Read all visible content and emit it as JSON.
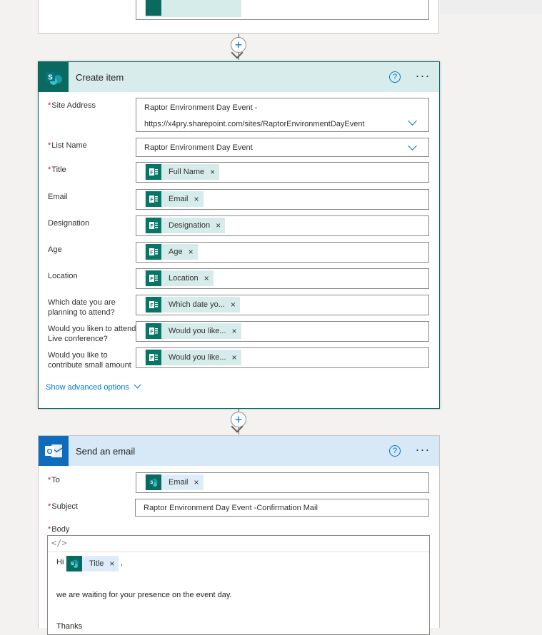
{
  "create_item": {
    "title": "Create item",
    "help_glyph": "?",
    "more_glyph": "···",
    "required_mark": "*",
    "site_address": {
      "label": "Site Address",
      "line1": "Raptor Environment Day Event -",
      "line2": "https://x4pry.sharepoint.com/sites/RaptorEnvironmentDayEvent"
    },
    "list_name": {
      "label": "List Name",
      "value": "Raptor Environment Day Event"
    },
    "title_field": {
      "label": "Title",
      "token": "Full Name"
    },
    "email": {
      "label": "Email",
      "token": "Email"
    },
    "designation": {
      "label": "Designation",
      "token": "Designation"
    },
    "age": {
      "label": "Age",
      "token": "Age"
    },
    "location": {
      "label": "Location",
      "token": "Location"
    },
    "date_attend": {
      "label": "Which date you are planning to attend?",
      "token": "Which date yo..."
    },
    "live_conf": {
      "label": "Would you liken to attend Live conference?",
      "token": "Would you like..."
    },
    "donation": {
      "label": "Would you like to contribute small amount as a donation?",
      "token": "Would you like..."
    },
    "advanced_options": "Show advanced options",
    "token_close": "×"
  },
  "send_email": {
    "title": "Send an email",
    "help_glyph": "?",
    "more_glyph": "···",
    "required_mark": "*",
    "to": {
      "label": "To",
      "token": "Email"
    },
    "subject": {
      "label": "Subject",
      "value": "Raptor Environment Day Event -Confirmation Mail"
    },
    "body": {
      "label": "Body",
      "code_glyph": "</>",
      "greeting": "Hi",
      "token": "Title",
      "comma": ",",
      "line2": "we are waiting for your presence on the event day.",
      "line3": "Thanks"
    },
    "token_close": "×"
  },
  "connector_plus": "+",
  "icons": {
    "sharepoint": "sharepoint-icon",
    "forms": "forms-icon",
    "outlook": "outlook-icon"
  },
  "colors": {
    "sharepoint_teal": "#0b6a5f",
    "outlook_blue": "#0f6cbd",
    "accent_blue": "#0078d4",
    "required_red": "#a4262c"
  }
}
